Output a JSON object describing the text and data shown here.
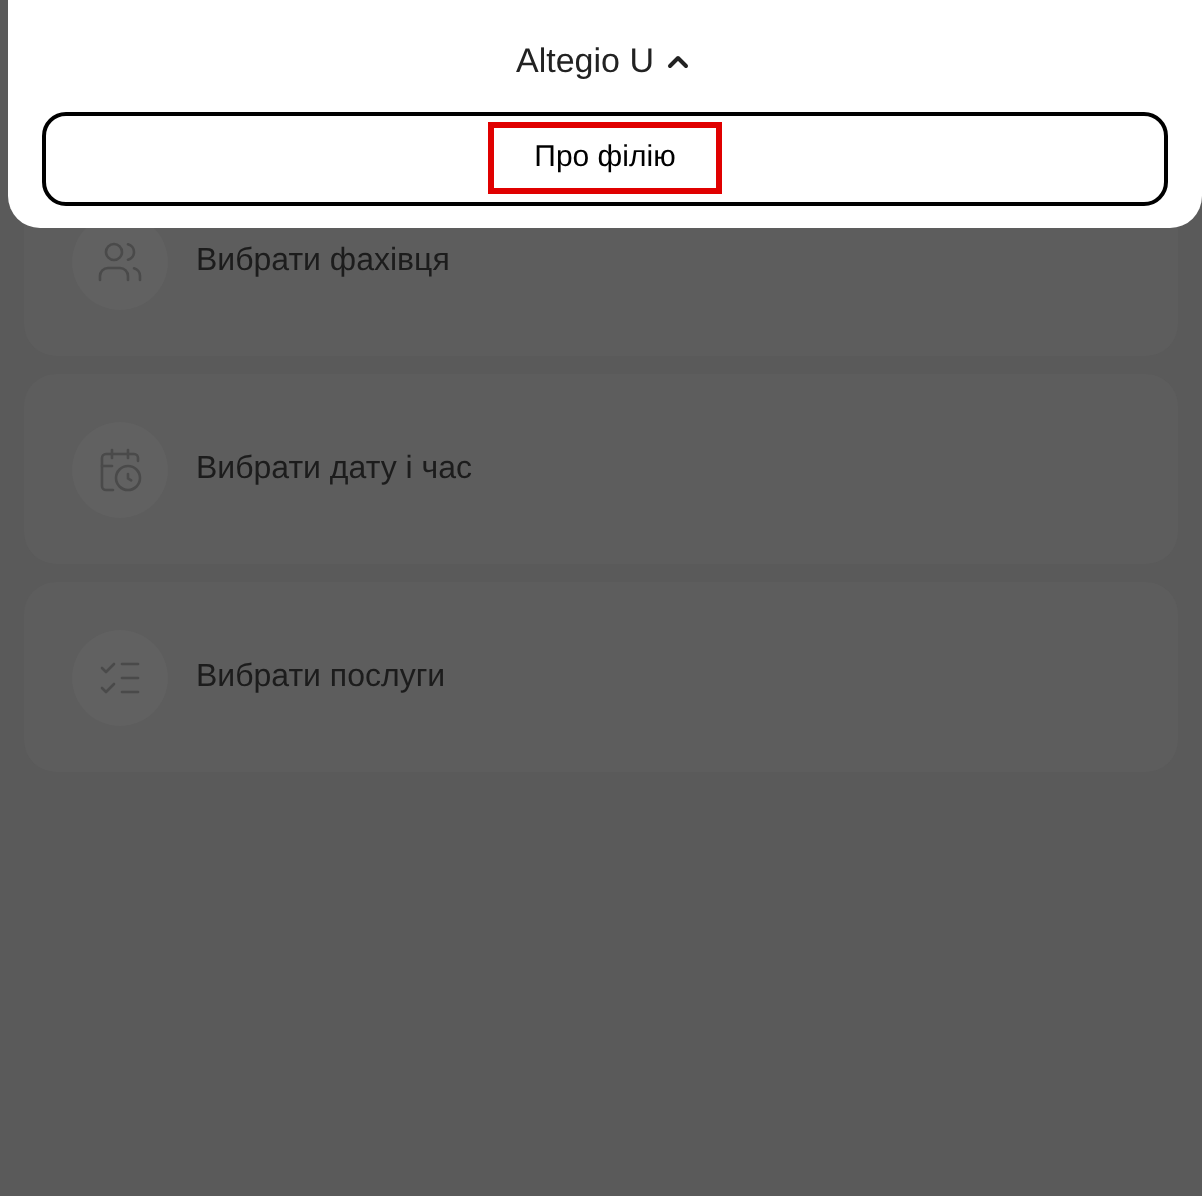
{
  "sheet": {
    "title": "Altegio U",
    "expanded": true,
    "button": {
      "label": "Про філію",
      "highlighted": true
    }
  },
  "steps": [
    {
      "kind": "specialist",
      "label": "Вибрати фахівця"
    },
    {
      "kind": "datetime",
      "label": "Вибрати дату і час"
    },
    {
      "kind": "services",
      "label": "Вибрати послуги"
    }
  ]
}
